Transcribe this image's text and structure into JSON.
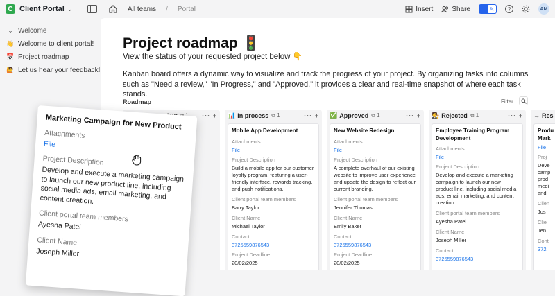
{
  "app": {
    "logo_letter": "C",
    "name": "Client Portal"
  },
  "breadcrumb": {
    "first": "All teams",
    "current": "Portal"
  },
  "toolbar": {
    "insert": "Insert",
    "share": "Share",
    "avatar": "AM"
  },
  "sidebar": {
    "group": "Welcome",
    "items": [
      {
        "icon": "👋",
        "label": "Welcome to client portal!"
      },
      {
        "icon": "📅",
        "label": "Project roadmap"
      },
      {
        "icon": "🙋",
        "label": "Let us hear your feedback!"
      }
    ]
  },
  "page": {
    "title": "Project roadmap 🚦",
    "subtitle": "View the status of your requested project below 👇",
    "description": "Kanban board offers a dynamic way to visualize and track the progress of your project. By organizing tasks into columns such as \"Need a review,\" \"In Progress,\" and \"Approved,\" it provides a clear and real-time snapshot of where each task stands.",
    "section_label": "Roadmap",
    "filter": "Filter"
  },
  "columns": [
    {
      "emoji": "••",
      "name": "Needs a review",
      "count": "1"
    },
    {
      "emoji": "📊",
      "name": "In process",
      "count": "1",
      "card": {
        "title": "Mobile App Development",
        "attachments_label": "Attachments",
        "file": "File",
        "desc_label": "Project Description",
        "desc": "Build a mobile app for our customer loyalty program, featuring a user-friendly interface, rewards tracking, and push notifications.",
        "members_label": "Client portal team members",
        "member": "Barry Taylor",
        "client_label": "Client Name",
        "client": "Michael Taylor",
        "contact_label": "Contact",
        "contact": "3725559876543",
        "deadline_label": "Project Deadline",
        "deadline": "20/02/2025"
      }
    },
    {
      "emoji": "✅",
      "name": "Approved",
      "count": "1",
      "card": {
        "title": "New Website Redesign",
        "attachments_label": "Attachments",
        "file": "File",
        "desc_label": "Project Description",
        "desc": "A complete overhaul of our existing website to improve user experience and update the design to reflect our current branding.",
        "members_label": "Client portal team members",
        "member": "Jennifer Thomas",
        "client_label": "Client Name",
        "client": "Emily Baker",
        "contact_label": "Contact",
        "contact": "3725559876543",
        "deadline_label": "Project Deadline",
        "deadline": "20/02/2025"
      }
    },
    {
      "emoji": "🧑‍⚖️",
      "name": "Rejected",
      "count": "1",
      "card": {
        "title": "Employee Training Program Development",
        "attachments_label": "Attachments",
        "file": "File",
        "desc_label": "Project Description",
        "desc": "Develop and execute a marketing campaign to launch our new product line, including social media ads, email marketing, and content creation.",
        "members_label": "Client portal team members",
        "member": "Ayesha Patel",
        "client_label": "Client Name",
        "client": "Joseph Miller",
        "contact_label": "Contact",
        "contact": "3725559876543"
      }
    },
    {
      "emoji": "→",
      "name": "Res",
      "card": {
        "title": "Produ",
        "title2": "Mark",
        "file": "File",
        "desc_label": "Proj",
        "desc": [
          "Deve",
          "camp",
          "prod",
          "medi",
          "and"
        ],
        "members_label": "Clien",
        "member": "Jos",
        "client_label": "Clie",
        "client": "Jen",
        "contact_label": "Cont",
        "contact": "372"
      }
    }
  ],
  "dragging_card": {
    "title": "Marketing Campaign for New Product",
    "attachments_label": "Attachments",
    "file": "File",
    "desc_label": "Project Description",
    "desc": "Develop and execute a marketing campaign to launch our new product line, including social media ads, email marketing, and content creation.",
    "members_label": "Client portal team members",
    "member": "Ayesha Patel",
    "client_label": "Client Name",
    "client": "Joseph Miller"
  }
}
